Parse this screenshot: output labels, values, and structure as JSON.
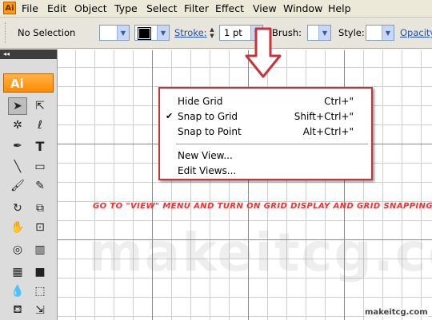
{
  "menubar": {
    "app_icon": "Ai",
    "items": [
      "File",
      "Edit",
      "Object",
      "Type",
      "Select",
      "Filter",
      "Effect",
      "View",
      "Window",
      "Help"
    ]
  },
  "controlbar": {
    "selection": "No Selection",
    "stroke_label": "Stroke:",
    "stroke_value": "1 pt",
    "brush_label": "Brush:",
    "style_label": "Style:",
    "opacity_label": "Opacity"
  },
  "tools": {
    "logo": "Ai"
  },
  "view_menu": {
    "items": [
      {
        "label": "Hide Grid",
        "shortcut": "Ctrl+\"",
        "checked": false
      },
      {
        "label": "Snap to Grid",
        "shortcut": "Shift+Ctrl+\"",
        "checked": true
      },
      {
        "label": "Snap to Point",
        "shortcut": "Alt+Ctrl+\"",
        "checked": false
      },
      {
        "label": "New View...",
        "shortcut": "",
        "checked": false
      },
      {
        "label": "Edit Views...",
        "shortcut": "",
        "checked": false
      }
    ]
  },
  "annotation": {
    "instruction": "GO TO \"VIEW\" MENU AND TURN ON GRID DISPLAY AND GRID SNAPPING.",
    "watermark": "makeitcg.com",
    "credit": "makeitcg.com",
    "accent_color": "#c8333a"
  }
}
